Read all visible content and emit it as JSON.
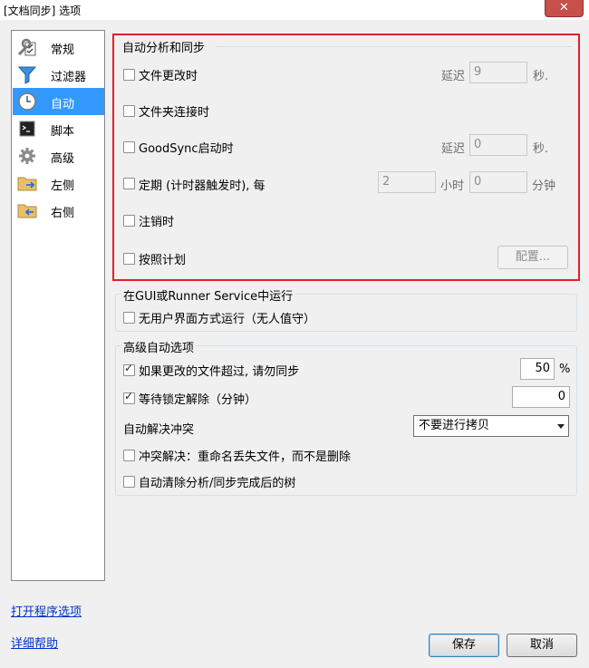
{
  "window": {
    "title": "[文档同步] 选项",
    "close": "✕"
  },
  "sidebar": {
    "items": [
      {
        "label": "常规"
      },
      {
        "label": "过滤器"
      },
      {
        "label": "自动"
      },
      {
        "label": "脚本"
      },
      {
        "label": "高级"
      },
      {
        "label": "左侧"
      },
      {
        "label": "右侧"
      }
    ],
    "selected": "自动"
  },
  "links": {
    "open_program_options": "打开程序选项",
    "detailed_help": "详细帮助"
  },
  "auto_group": {
    "title": "自动分析和同步",
    "file_change": {
      "label": "文件更改时",
      "checked": false,
      "delay_label": "延迟",
      "delay_value": "9",
      "unit": "秒."
    },
    "folder_connect": {
      "label": "文件夹连接时",
      "checked": false
    },
    "goodsync_start": {
      "label": "GoodSync启动时",
      "checked": false,
      "delay_label": "延迟",
      "delay_value": "0",
      "unit": "秒."
    },
    "periodic": {
      "label": "定期 (计时器触发时), 每",
      "checked": false,
      "hours_value": "2",
      "hours_unit": "小时",
      "minutes_value": "0",
      "minutes_unit": "分钟"
    },
    "logoff": {
      "label": "注销时",
      "checked": false
    },
    "schedule": {
      "label": "按照计划",
      "checked": false,
      "config_button": "配置..."
    }
  },
  "runner_group": {
    "title": "在GUI或Runner Service中运行",
    "unattended": {
      "label": "无用户界面方式运行（无人值守）",
      "checked": false
    }
  },
  "advanced_group": {
    "title": "高级自动选项",
    "skip_if_changed": {
      "label": "如果更改的文件超过, 请勿同步",
      "checked": true,
      "value": "50",
      "unit": "%"
    },
    "wait_unlock": {
      "label": "等待锁定解除（分钟）",
      "checked": true,
      "value": "0"
    },
    "conflict": {
      "label": "自动解决冲突",
      "selected": "不要进行拷贝"
    },
    "rename_lost": {
      "label": "冲突解决：重命名丢失文件，而不是删除",
      "checked": false
    },
    "clear_tree": {
      "label": "自动清除分析/同步完成后的树",
      "checked": false
    }
  },
  "buttons": {
    "save": "保存",
    "cancel": "取消"
  },
  "colors": {
    "highlight": "#3399ff",
    "red_box": "#e0202a",
    "link": "#0033cc"
  }
}
